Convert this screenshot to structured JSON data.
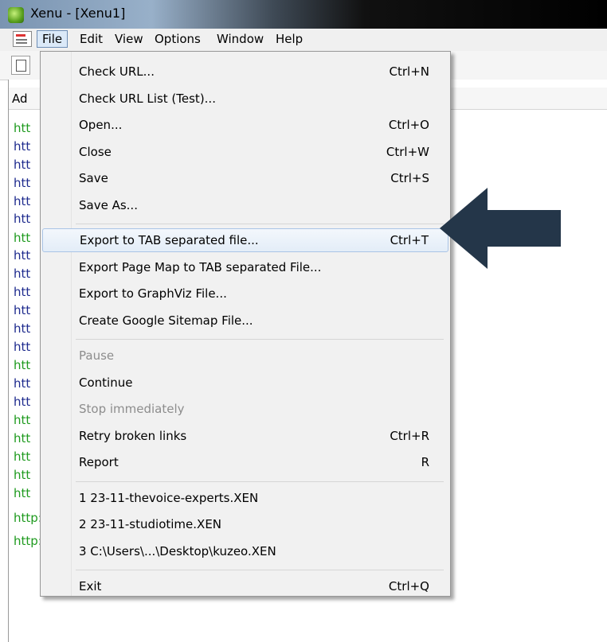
{
  "window": {
    "title": "Xenu - [Xenu1]"
  },
  "menubar": {
    "items": [
      "File",
      "Edit",
      "View",
      "Options",
      "Window",
      "Help"
    ]
  },
  "columns": {
    "address_label": "Ad"
  },
  "file_menu": {
    "groups": [
      [
        {
          "label": "Check URL...",
          "shortcut": "Ctrl+N"
        },
        {
          "label": "Check URL List (Test)...",
          "shortcut": ""
        },
        {
          "label": "Open...",
          "shortcut": "Ctrl+O"
        },
        {
          "label": "Close",
          "shortcut": "Ctrl+W"
        },
        {
          "label": "Save",
          "shortcut": "Ctrl+S"
        },
        {
          "label": "Save As...",
          "shortcut": ""
        }
      ],
      [
        {
          "label": "Export to TAB separated file...",
          "shortcut": "Ctrl+T",
          "highlighted": true
        },
        {
          "label": "Export Page Map to TAB separated File...",
          "shortcut": ""
        },
        {
          "label": "Export to GraphViz File...",
          "shortcut": ""
        },
        {
          "label": "Create Google Sitemap File...",
          "shortcut": ""
        }
      ],
      [
        {
          "label": "Pause",
          "shortcut": "",
          "disabled": true
        },
        {
          "label": "Continue",
          "shortcut": ""
        },
        {
          "label": "Stop immediately",
          "shortcut": "",
          "disabled": true
        },
        {
          "label": "Retry broken links",
          "shortcut": "Ctrl+R"
        },
        {
          "label": "Report",
          "shortcut": "R"
        }
      ],
      [
        {
          "label": "1 23-11-thevoice-experts.XEN",
          "shortcut": ""
        },
        {
          "label": "2 23-11-studiotime.XEN",
          "shortcut": ""
        },
        {
          "label": "3 C:\\Users\\...\\Desktop\\kuzeo.XEN",
          "shortcut": ""
        }
      ],
      [
        {
          "label": "Exit",
          "shortcut": "Ctrl+Q"
        }
      ]
    ]
  },
  "url_rows": [
    {
      "text": "htt",
      "color": "green"
    },
    {
      "text": "htt",
      "color": "blue"
    },
    {
      "text": "htt",
      "color": "blue"
    },
    {
      "text": "htt",
      "color": "blue"
    },
    {
      "text": "htt",
      "color": "blue"
    },
    {
      "text": "htt",
      "color": "blue"
    },
    {
      "text": "htt",
      "color": "green"
    },
    {
      "text": "htt",
      "color": "blue"
    },
    {
      "text": "htt",
      "color": "blue"
    },
    {
      "text": "htt",
      "color": "blue"
    },
    {
      "text": "htt",
      "color": "blue"
    },
    {
      "text": "htt",
      "color": "blue"
    },
    {
      "text": "htt",
      "color": "blue"
    },
    {
      "text": "htt",
      "color": "green"
    },
    {
      "text": "htt",
      "color": "blue"
    },
    {
      "text": "htt",
      "color": "blue"
    },
    {
      "text": "htt",
      "color": "green"
    },
    {
      "text": "htt",
      "color": "green"
    },
    {
      "text": "htt",
      "color": "green"
    },
    {
      "text": "htt",
      "color": "green"
    },
    {
      "text": "htt",
      "color": "green"
    },
    {
      "text": "http://www.seomix.fr/wordpress/utilisation/",
      "color": "green"
    },
    {
      "text": "http://www.seomix.fr/wordpress/referencement-wp/",
      "color": "green"
    }
  ],
  "colors": {
    "link_green": "#1e9a1e",
    "link_blue": "#1d2a8d",
    "arrow": "#243649",
    "highlight_border": "#a9c4e6"
  },
  "icons": {
    "app": "xenu-icon",
    "doc": "document-icon",
    "toolbar": "new-file-icon"
  }
}
